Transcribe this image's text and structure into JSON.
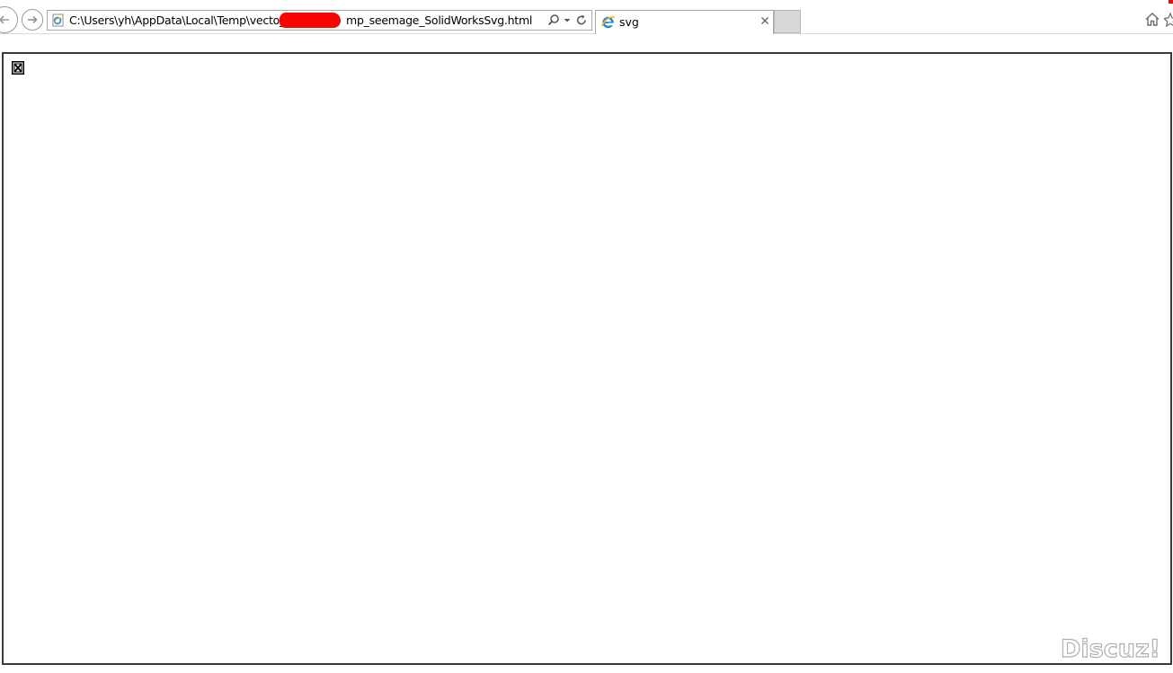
{
  "browser": {
    "address": {
      "url_prefix": "C:\\Users\\yh\\AppData\\Local\\Temp\\vecto_",
      "url_suffix": "mp_seemage_SolidWorksSvg.html"
    },
    "tab": {
      "title": "svg"
    },
    "icons": {
      "back": "back-arrow-icon",
      "forward": "forward-arrow-icon",
      "page": "ie-page-icon",
      "search": "search-icon",
      "dropdown": "chevron-down-icon",
      "refresh": "refresh-icon",
      "tab_favicon": "ie-logo-icon",
      "tab_close": "close-icon",
      "home": "home-icon",
      "favorites": "star-icon",
      "broken_image": "broken-image-icon"
    }
  },
  "content": {
    "watermark": "Discuz!"
  },
  "colors": {
    "redaction": "#ff0000",
    "frame_border": "#3a3a3a",
    "ie_blue": "#1e88d2",
    "ie_yellow": "#f2b820"
  }
}
